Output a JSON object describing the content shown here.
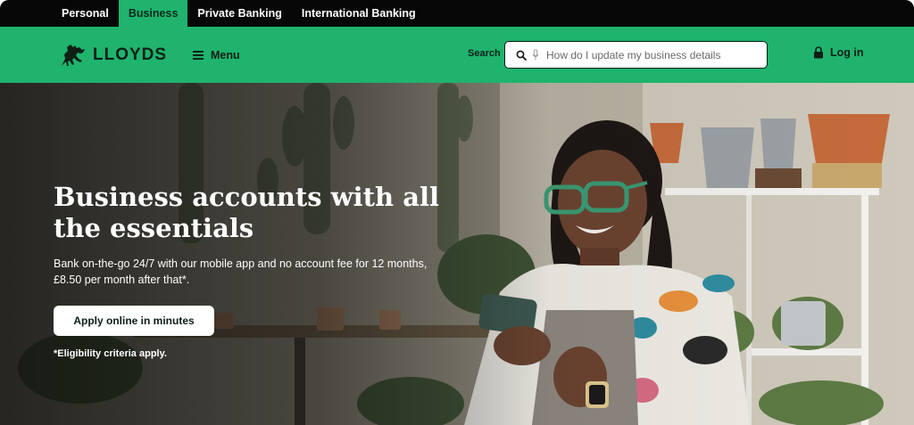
{
  "segments": [
    {
      "label": "Personal",
      "active": false
    },
    {
      "label": "Business",
      "active": true
    },
    {
      "label": "Private Banking",
      "active": false
    },
    {
      "label": "International Banking",
      "active": false
    }
  ],
  "header": {
    "brand": "LLOYDS",
    "menu_label": "Menu",
    "search_label": "Search",
    "search_placeholder": "How do I update my business details",
    "login_label": "Log in"
  },
  "hero": {
    "title": "Business accounts with all the essentials",
    "subtitle": "Bank on-the-go 24/7 with our mobile app and no account fee for 12 months, £8.50 per month after that*.",
    "cta_label": "Apply online in minutes",
    "note": "*Eligibility criteria apply."
  },
  "colors": {
    "brand_green": "#1fb36e",
    "topbar": "#070707",
    "text_dark": "#0d1f16"
  }
}
